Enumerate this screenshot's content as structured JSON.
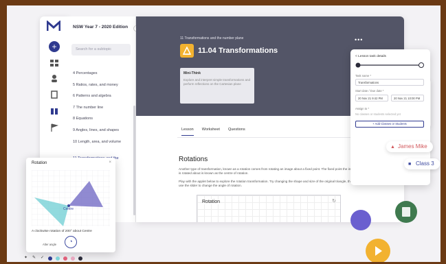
{
  "app": {
    "edition": "NSW Year 7 - 2020 Edition",
    "search_placeholder": "Search for a subtopic"
  },
  "sidebar": {
    "chapters": [
      {
        "label": "4 Percentages"
      },
      {
        "label": "5 Ratios, rates, and money"
      },
      {
        "label": "6 Patterns and algebra"
      },
      {
        "label": "7 The number line"
      },
      {
        "label": "8 Equations"
      },
      {
        "label": "9 Angles, lines, and shapes"
      },
      {
        "label": "10 Length, area, and volume"
      },
      {
        "label": "11 Transformations and the number plane"
      }
    ]
  },
  "lesson": {
    "breadcrumb": "11 Transformations and the number plane",
    "title": "11.04 Transformations",
    "info_heading": "Mini-Think",
    "info_text": "Explore and interpret simple transformations and perform reflections on the Cartesian plane"
  },
  "tabs": [
    "Lesson",
    "Worksheet",
    "Questions"
  ],
  "content": {
    "section_title": "Rotations",
    "para1": "Another type of transformation, known as a rotation comes from rotating an image about a fixed point. The fixed point the image is rotated about is known as the centre of rotation.",
    "para2": "Play with the applet below to explore the rotation transformation. Try changing the shape and size of the original triangle, then use the slider to change the angle of rotation.",
    "applet_label": "Rotation"
  },
  "task_panel": {
    "heading": "< Lesson task details",
    "task_name_label": "Task name *",
    "task_name_value": "Transformations",
    "start_due_label": "Start date / Due date *",
    "start_value": "20 Nov 21 9:42 PM",
    "due_value": "20 Nov 21 10:00 PM",
    "assign_label": "Assign to *",
    "assign_hint": "No classes or students selected yet",
    "assign_button": "+ Add Classes or Students"
  },
  "chips": {
    "student": "James Mike",
    "class": "Class 3"
  },
  "popup": {
    "title": "Rotation",
    "caption": "A clockwise rotation of 200° about Centre",
    "slider_label": "Alter angle",
    "point_label": "Centre"
  },
  "colors": {
    "brand": "#2f3a8f",
    "hero": "#535567",
    "accent_yellow": "#f2b230",
    "chip_red": "#d2585c",
    "shape_purple": "#7d76c9",
    "shape_cyan": "#7fd3d8"
  },
  "icons": {
    "close": "×",
    "refresh": "↻",
    "collapse": "‹",
    "more": "•••"
  }
}
